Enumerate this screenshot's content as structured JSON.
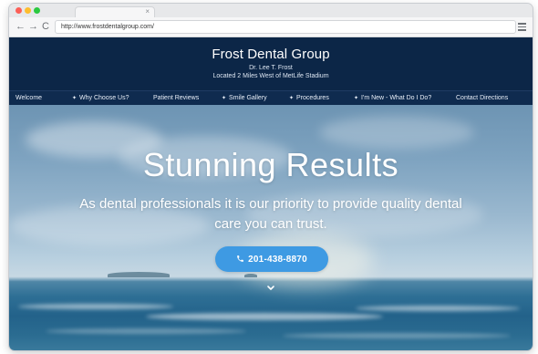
{
  "browser": {
    "tab_close": "×",
    "back": "←",
    "forward": "→",
    "reload": "C",
    "url": "http://www.frostdentalgroup.com/"
  },
  "site": {
    "title": "Frost Dental Group",
    "doctor": "Dr. Lee T. Frost",
    "location": "Located 2 Miles West of MetLife Stadium"
  },
  "nav": [
    {
      "label": "Welcome",
      "has_star": false
    },
    {
      "label": "Why Choose Us?",
      "has_star": true
    },
    {
      "label": "Patient Reviews",
      "has_star": false
    },
    {
      "label": "Smile Gallery",
      "has_star": true
    },
    {
      "label": "Procedures",
      "has_star": true
    },
    {
      "label": "I'm New - What Do I Do?",
      "has_star": true
    },
    {
      "label": "Contact Directions",
      "has_star": false
    }
  ],
  "nav_star": "✦",
  "hero": {
    "title": "Stunning Results",
    "tagline": "As dental professionals it is our priority to provide quality dental care you can trust.",
    "phone_icon": "phone-icon",
    "phone": "201-438-8870"
  },
  "colors": {
    "header_bg": "#0c2647",
    "nav_bg": "#0f2b4f",
    "button_bg": "#3e9ae3"
  }
}
